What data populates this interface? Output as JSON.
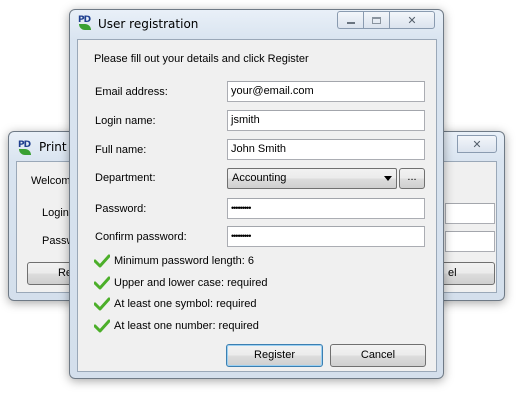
{
  "background_window": {
    "title": "Print D",
    "welcome_text": "Welcom",
    "login_label": "Login",
    "password_label": "Passw",
    "left_button_label": "Re",
    "right_button_label": "el",
    "close_glyph": "✕"
  },
  "dialog": {
    "title": "User registration",
    "instruction": "Please fill out your details and click Register",
    "caption": {
      "minimize": "",
      "maximize": "",
      "close": "✕"
    },
    "fields": {
      "email": {
        "label": "Email address:",
        "value": "your@email.com"
      },
      "login": {
        "label": "Login name:",
        "value": "jsmith"
      },
      "fullname": {
        "label": "Full name:",
        "value": "John Smith"
      },
      "department": {
        "label": "Department:",
        "value": "Accounting",
        "browse_label": "..."
      },
      "password": {
        "label": "Password:",
        "value": "•••••••••"
      },
      "confirm": {
        "label": "Confirm password:",
        "value": "•••••••••"
      }
    },
    "requirements": [
      "Minimum password length: 6",
      "Upper and lower case: required",
      "At least one symbol: required",
      "At least one number: required"
    ],
    "buttons": {
      "register": "Register",
      "cancel": "Cancel"
    }
  },
  "icons": {
    "app": "printdirector-pd-icon",
    "requirement": "checkmark-icon"
  },
  "colors": {
    "check_green": "#4caf2a",
    "default_button_border": "#3c7fb1"
  }
}
